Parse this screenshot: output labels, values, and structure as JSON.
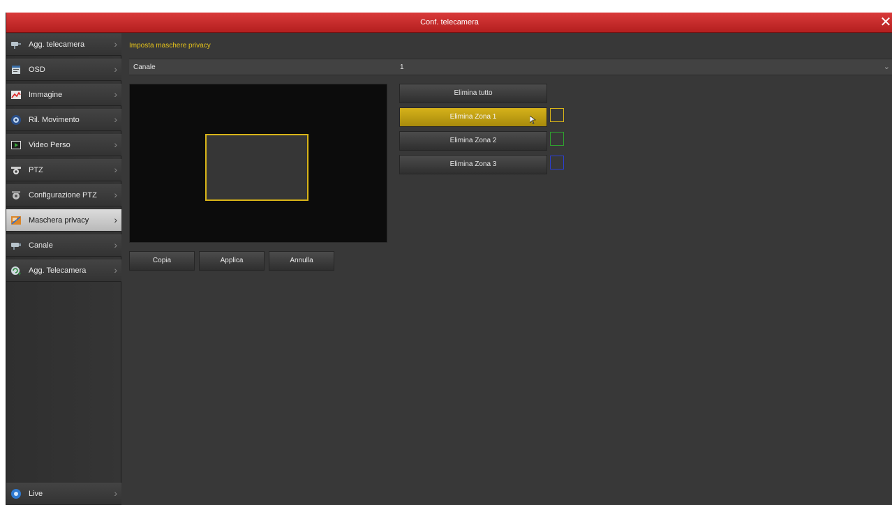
{
  "window": {
    "title": "Conf. telecamera"
  },
  "sidebar": {
    "items": [
      {
        "label": "Agg. telecamera",
        "icon": "camera-add-icon"
      },
      {
        "label": "OSD",
        "icon": "osd-icon"
      },
      {
        "label": "Immagine",
        "icon": "image-icon"
      },
      {
        "label": "Ril. Movimento",
        "icon": "motion-detect-icon"
      },
      {
        "label": "Video Perso",
        "icon": "video-loss-icon"
      },
      {
        "label": "PTZ",
        "icon": "ptz-icon"
      },
      {
        "label": "Configurazione PTZ",
        "icon": "ptz-config-icon"
      },
      {
        "label": "Maschera privacy",
        "icon": "privacy-mask-icon",
        "active": true
      },
      {
        "label": "Canale",
        "icon": "channel-icon"
      },
      {
        "label": "Agg. Telecamera",
        "icon": "camera-update-icon"
      }
    ],
    "live": {
      "label": "Live",
      "icon": "live-icon"
    }
  },
  "main": {
    "section_title": "Imposta maschere privacy",
    "channel": {
      "label": "Canale",
      "value": "1"
    },
    "zone_buttons": {
      "delete_all": "Elimina tutto",
      "zones": [
        {
          "label": "Elimina Zona 1",
          "color": "#d8b418",
          "active": true
        },
        {
          "label": "Elimina Zona 2",
          "color": "#2fa12f"
        },
        {
          "label": "Elimina Zona 3",
          "color": "#2b3fd0"
        }
      ]
    },
    "actions": {
      "copy": "Copia",
      "apply": "Applica",
      "cancel": "Annulla"
    }
  },
  "colors": {
    "accent_red": "#c62828",
    "accent_yellow": "#d8b418",
    "section_title": "#e5c21a"
  }
}
